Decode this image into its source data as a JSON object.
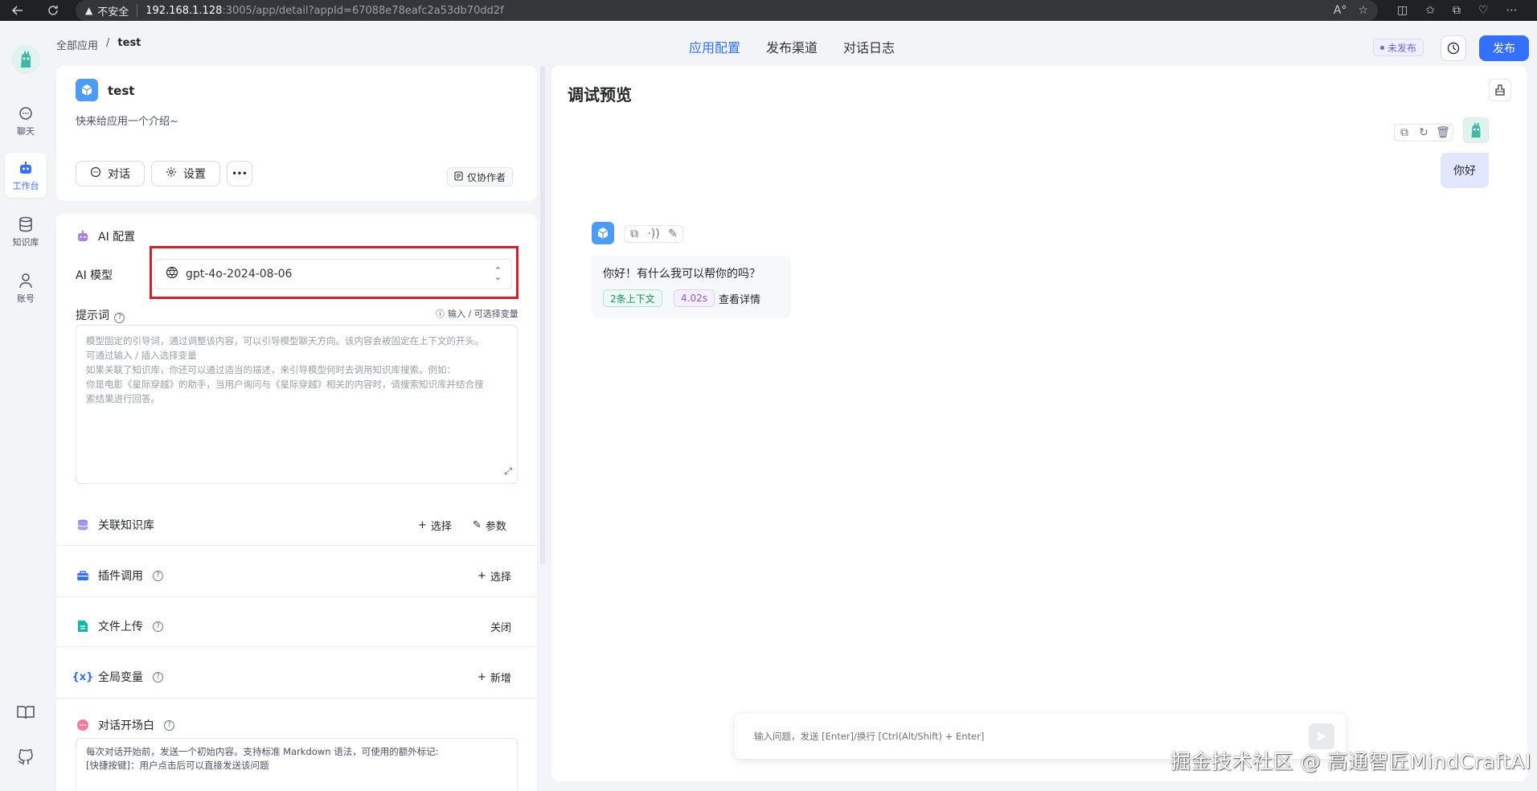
{
  "browser": {
    "insecure_label": "不安全",
    "url_host": "192.168.1.128",
    "url_path": ":3005/app/detail?appId=67088e78eafc2a53db70dd2f"
  },
  "nav": {
    "items": [
      {
        "label": "聊天",
        "icon": "chat-icon"
      },
      {
        "label": "工作台",
        "icon": "robot-icon"
      },
      {
        "label": "知识库",
        "icon": "database-icon"
      },
      {
        "label": "账号",
        "icon": "user-icon"
      }
    ],
    "bottom_icons": [
      "book-icon",
      "github-icon"
    ]
  },
  "header": {
    "breadcrumb_root": "全部应用",
    "breadcrumb_sep": "/",
    "breadcrumb_current": "test",
    "tabs": [
      "应用配置",
      "发布渠道",
      "对话日志"
    ],
    "status_badge": "未发布",
    "publish_label": "发布"
  },
  "app": {
    "name": "test",
    "intro": "快来给应用一个介绍~",
    "chat_label": "对话",
    "settings_label": "设置",
    "more_label": "•••",
    "permission_label": "仅协作者"
  },
  "config": {
    "ai_title": "AI 配置",
    "model_label": "AI 模型",
    "model_value": "gpt-4o-2024-08-06",
    "prompt_label": "提示词",
    "prompt_hint": "输入 / 可选择变量",
    "prompt_placeholder": [
      "模型固定的引导词，通过调整该内容，可以引导模型聊天方向。该内容会被固定在上下文的开头。",
      "可通过输入 / 插入选择变量",
      "如果关联了知识库，你还可以通过适当的描述，来引导模型何时去调用知识库搜索。例如：",
      "你是电影《星际穿越》的助手，当用户询问与《星际穿越》相关的内容时，请搜索知识库并结合搜",
      "索结果进行回答。"
    ],
    "dataset_title": "关联知识库",
    "dataset_select": "选择",
    "dataset_params": "参数",
    "plugin_title": "插件调用",
    "plugin_select": "选择",
    "file_title": "文件上传",
    "file_status": "关闭",
    "var_title": "全局变量",
    "var_add": "新增",
    "welcome_title": "对话开场白",
    "welcome_placeholder": [
      "每次对话开始前，发送一个初始内容。支持标准 Markdown 语法，可使用的额外标记:",
      "[快捷按键]：用户点击后可以直接发送该问题"
    ]
  },
  "preview": {
    "title": "调试预览",
    "user_message": "你好",
    "bot_message": "你好！有什么我可以帮你的吗？",
    "context_tag": "2条上下文",
    "time_tag": "4.02s",
    "detail_label": "查看详情",
    "input_placeholder": "输入问题，发送 [Enter]/换行 [Ctrl(Alt/Shift) + Enter]"
  },
  "watermark": "掘金技术社区 @ 高通智匠MindCraftAI",
  "colors": {
    "accent": "#3370ff",
    "highlight_box": "#d8202a"
  }
}
